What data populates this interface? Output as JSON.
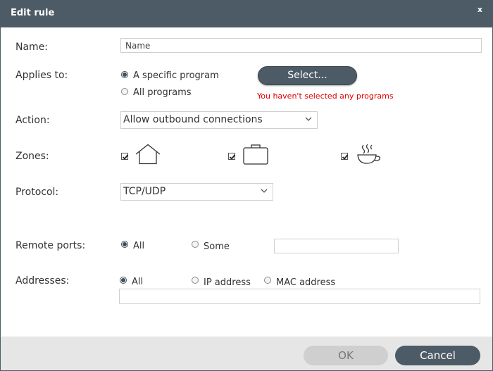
{
  "dialog": {
    "title": "Edit rule",
    "close_label": "x"
  },
  "name": {
    "label": "Name:",
    "value": "Name"
  },
  "applies_to": {
    "label": "Applies to:",
    "options": [
      "A specific program",
      "All programs"
    ],
    "selected": "A specific program",
    "select_button": "Select...",
    "error": "You haven't selected any programs"
  },
  "action": {
    "label": "Action:",
    "value": "Allow outbound connections"
  },
  "zones": {
    "label": "Zones:",
    "items": [
      {
        "icon": "home-icon",
        "checked": true
      },
      {
        "icon": "briefcase-icon",
        "checked": true
      },
      {
        "icon": "coffee-cup-icon",
        "checked": true
      }
    ]
  },
  "protocol": {
    "label": "Protocol:",
    "value": "TCP/UDP"
  },
  "remote_ports": {
    "label": "Remote ports:",
    "options": [
      "All",
      "Some"
    ],
    "selected": "All",
    "value": ""
  },
  "addresses": {
    "label": "Addresses:",
    "options": [
      "All",
      "IP address",
      "MAC address"
    ],
    "selected": "All",
    "value": ""
  },
  "footer": {
    "ok": "OK",
    "cancel": "Cancel"
  },
  "colors": {
    "titlebar": "#4d5b66",
    "error": "#e00000",
    "footer": "#e6e6e6"
  }
}
